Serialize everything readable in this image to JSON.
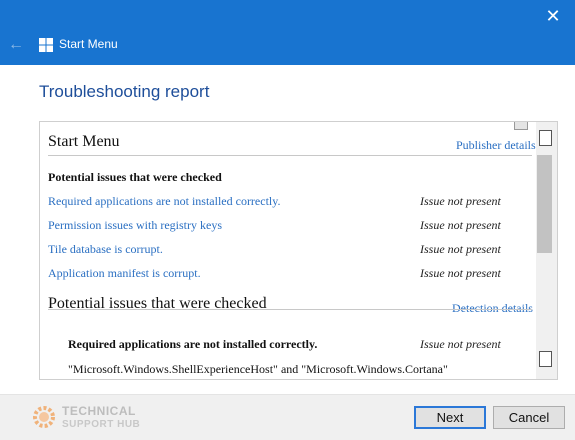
{
  "titlebar": {
    "title": "Start Menu",
    "close_glyph": "✕",
    "back_glyph": "←",
    "logo_icon": "windows-logo-icon"
  },
  "heading": "Troubleshooting report",
  "report": {
    "section_title": "Start Menu",
    "publisher_link": "Publisher details",
    "checked_heading": "Potential issues that were checked",
    "rows": [
      {
        "issue": "Required applications are not installed correctly.",
        "status": "Issue not present"
      },
      {
        "issue": "Permission issues with registry keys",
        "status": "Issue not present"
      },
      {
        "issue": "Tile database is corrupt.",
        "status": "Issue not present"
      },
      {
        "issue": "Application manifest is corrupt.",
        "status": "Issue not present"
      }
    ],
    "section2_title": "Potential issues that were checked",
    "detection_link": "Detection details",
    "detail": {
      "heading": "Required applications are not installed correctly.",
      "status": "Issue not present",
      "text": "\"Microsoft.Windows.ShellExperienceHost\" and \"Microsoft.Windows.Cortana\""
    }
  },
  "footer": {
    "watermark_line1": "TECHNICAL",
    "watermark_line2": "SUPPORT HUB",
    "next_label": "Next",
    "cancel_label": "Cancel"
  },
  "colors": {
    "titlebar": "#1874d0",
    "heading": "#1e4e9a",
    "link": "#2a6fc2",
    "footer": "#f0f0f0"
  }
}
